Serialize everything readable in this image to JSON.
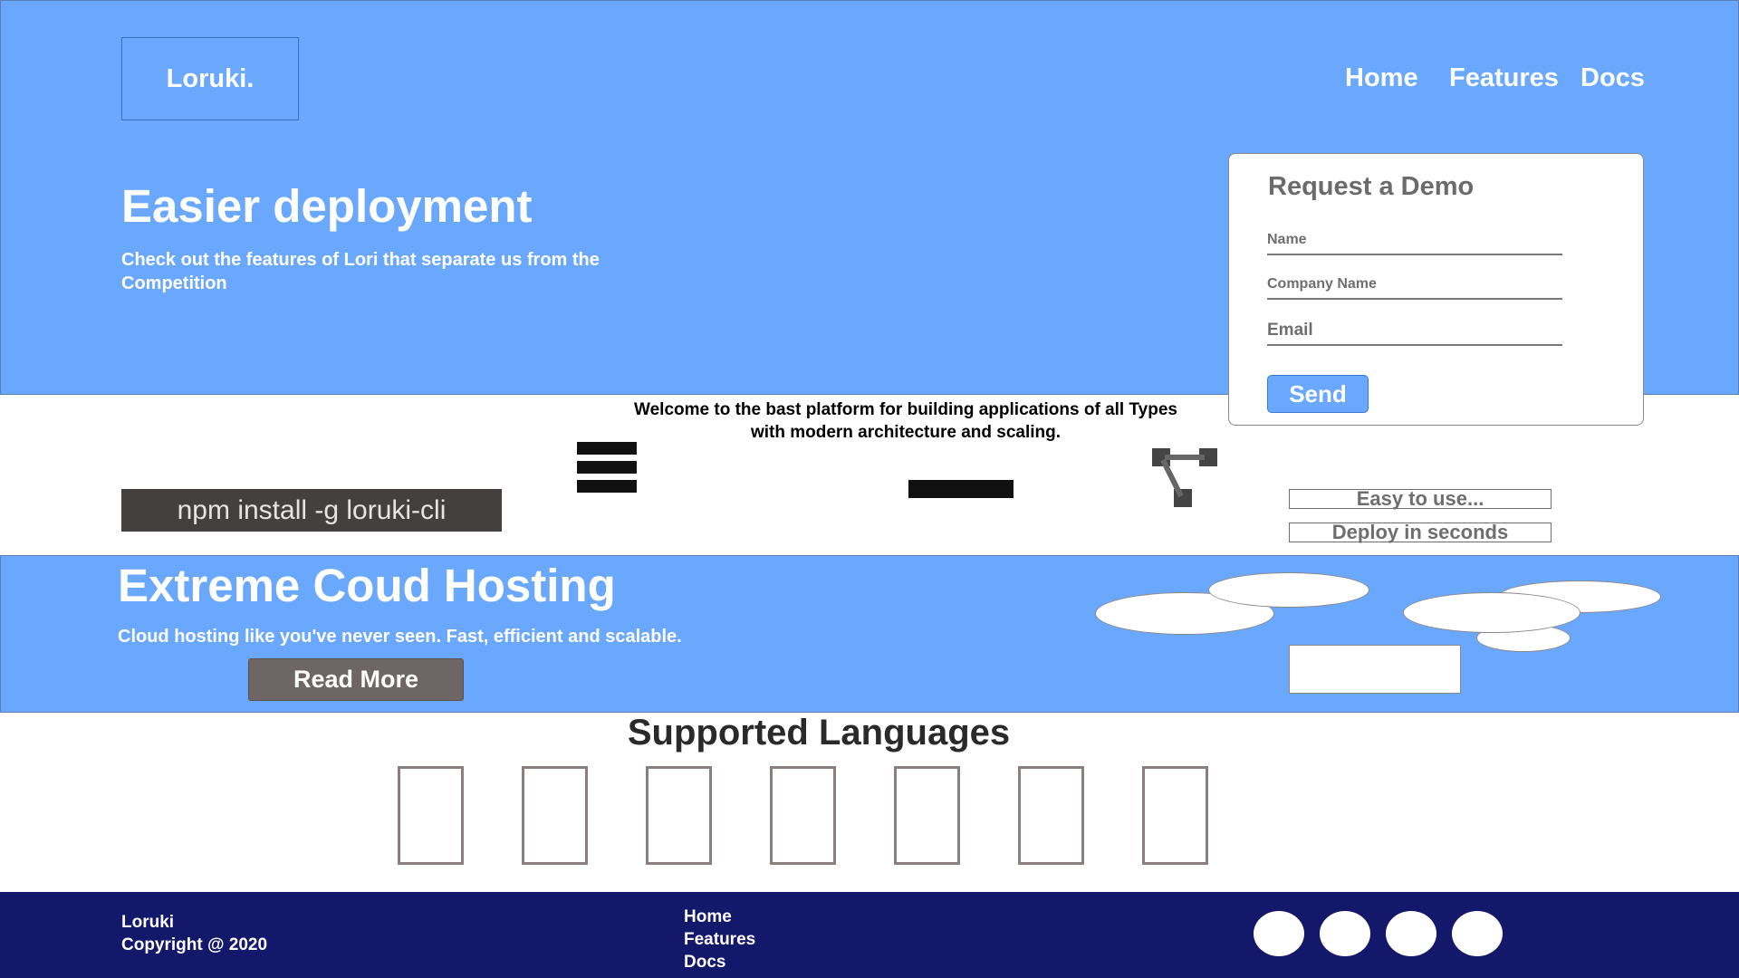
{
  "brand": {
    "logo": "Loruki."
  },
  "nav": {
    "items": [
      "Home",
      "Features",
      "Docs"
    ]
  },
  "hero": {
    "title": "Easier deployment",
    "subtitle": "Check out the features of Lori that separate us from the Competition"
  },
  "demo_form": {
    "title": "Request a Demo",
    "name_placeholder": "Name",
    "company_placeholder": "Company Name",
    "email_placeholder": "Email",
    "send_label": "Send"
  },
  "stats": {
    "welcome": "Welcome to the bast platform for building applications of all Types with modern architecture and scaling.",
    "install_command": "npm install -g loruki-cli",
    "icons": [
      "menu-icon",
      "minus-icon",
      "git-branch-icon"
    ],
    "pill_1": "Easy to use...",
    "pill_2": "Deploy in seconds"
  },
  "hosting": {
    "title": "Extreme Coud Hosting",
    "subtitle": "Cloud hosting like you've never seen. Fast, efficient and scalable.",
    "read_more": "Read More"
  },
  "languages": {
    "title": "Supported Languages",
    "count": 7
  },
  "footer": {
    "brand": "Loruki",
    "copyright": "Copyright @ 2020",
    "links": [
      "Home",
      "Features",
      "Docs"
    ],
    "social_count": 4
  },
  "colors": {
    "primary_blue": "#6aa8fe",
    "footer_navy": "#13186b",
    "dark_gray": "#454040"
  }
}
